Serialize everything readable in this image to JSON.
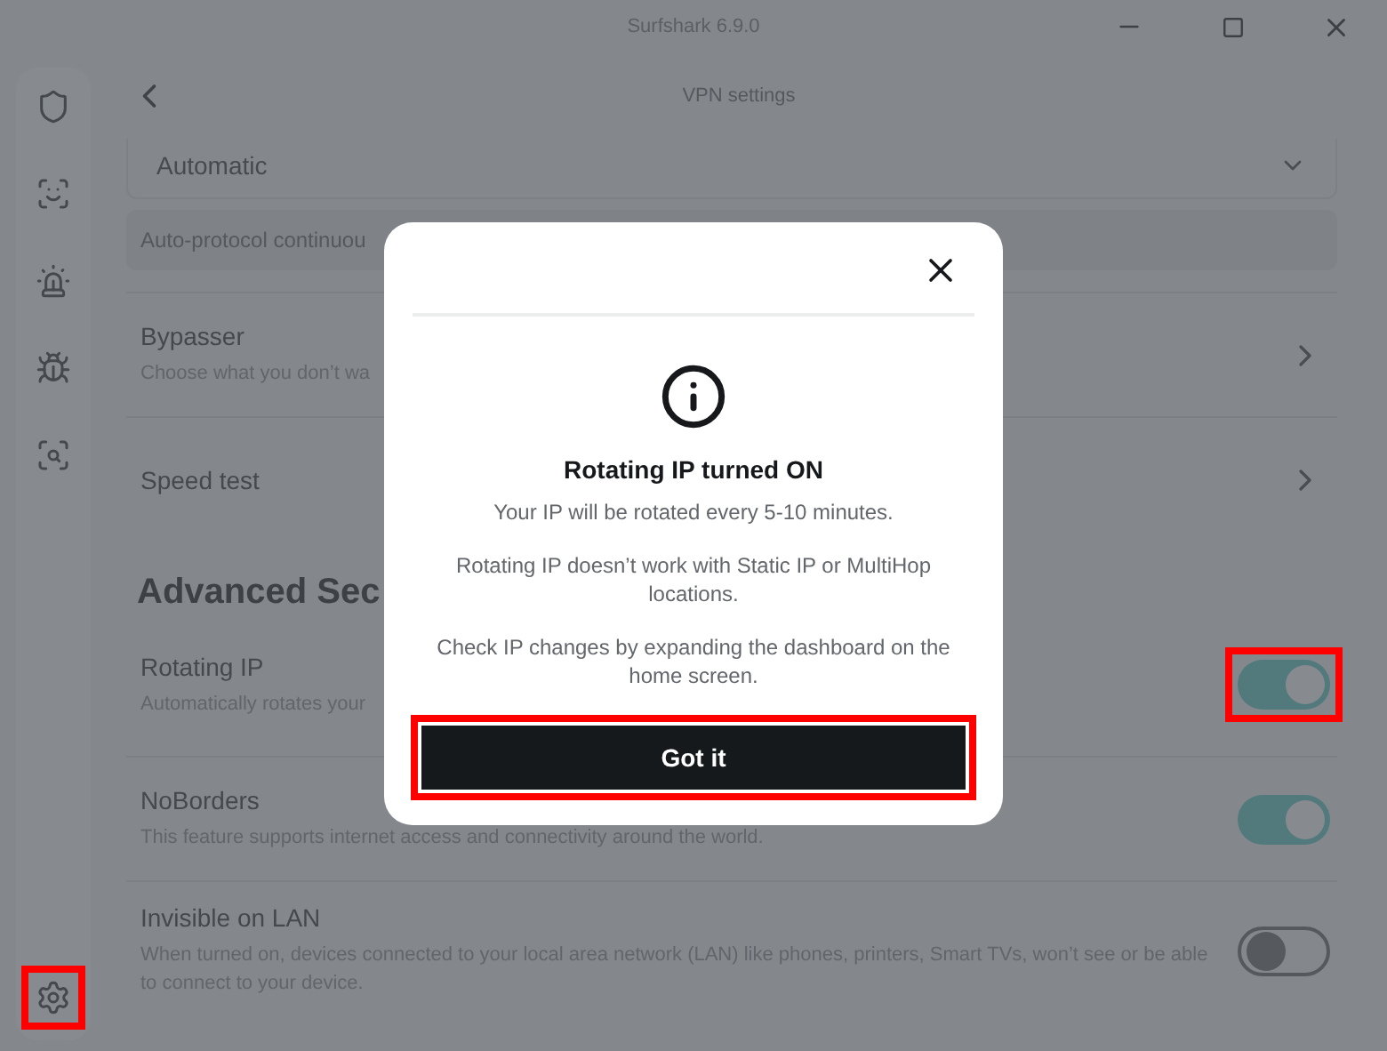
{
  "window": {
    "title": "Surfshark 6.9.0"
  },
  "sidebar": {
    "items": [
      {
        "kind": "shield"
      },
      {
        "kind": "face"
      },
      {
        "kind": "alert"
      },
      {
        "kind": "bug"
      },
      {
        "kind": "search"
      }
    ],
    "bottom": {
      "kind": "settings",
      "highlighted": true
    }
  },
  "header": {
    "title": "VPN settings"
  },
  "protocol": {
    "value": "Automatic",
    "note": "Auto-protocol continuou"
  },
  "nav_rows": [
    {
      "title": "Bypasser",
      "description": "Choose what you don’t wa"
    },
    {
      "title": "Speed test"
    }
  ],
  "section": {
    "heading": "Advanced Sec"
  },
  "toggles": [
    {
      "title": "Rotating IP",
      "description": "Automatically rotates your",
      "on": true,
      "highlighted": true
    },
    {
      "title": "NoBorders",
      "description": "This feature supports internet access and connectivity around the world.",
      "on": true,
      "highlighted": false
    },
    {
      "title": "Invisible on LAN",
      "description": "When turned on, devices connected to your local area network (LAN) like phones, printers, Smart TVs, won’t see or be able to connect to your device.",
      "on": false,
      "highlighted": false
    }
  ],
  "dialog": {
    "title": "Rotating IP turned ON",
    "paragraphs": [
      "Your IP will be rotated every 5-10 minutes.",
      "Rotating IP doesn’t work with Static IP or MultiHop locations.",
      "Check IP changes by expanding the dashboard on the home screen."
    ],
    "button": {
      "label": "Got it",
      "highlighted": true
    }
  }
}
